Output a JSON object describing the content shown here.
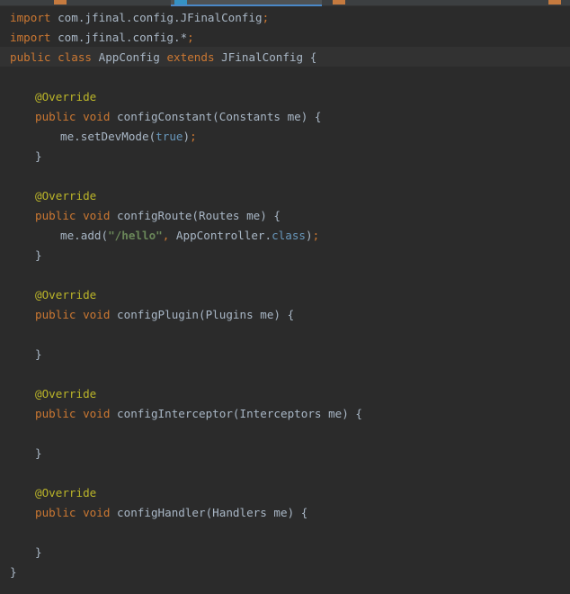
{
  "tabs": [
    {
      "label": "...",
      "active": false,
      "icon": "java-class-icon"
    },
    {
      "label": "...",
      "active": true,
      "icon": "java-class-icon"
    },
    {
      "label": "...",
      "active": false,
      "icon": "java-class-icon"
    },
    {
      "label": "",
      "active": false,
      "icon": "java-class-icon"
    }
  ],
  "colors": {
    "background": "#2b2b2b",
    "keyword": "#cc7832",
    "annotation": "#bbb529",
    "string": "#6a8759",
    "literal": "#6897bb",
    "text": "#a9b7c6",
    "current_line": "#323232"
  },
  "code": {
    "l1": {
      "kw": "import",
      "rest": "com.jfinal.config.JFinalConfig",
      "semi": ";"
    },
    "l2": {
      "kw": "import",
      "rest": "com.jfinal.config.*",
      "semi": ";"
    },
    "l3": {
      "kw1": "public",
      "kw2": "class",
      "name": "AppConfig",
      "kw3": "extends",
      "parent": "JFinalConfig",
      "brace": "{"
    },
    "override": "@Override",
    "public": "public",
    "void": "void",
    "m1": {
      "sig": "configConstant(Constants me) {",
      "body_pre": "me.setDevMode(",
      "body_lit": "true",
      "body_post": ")",
      "semi": ";"
    },
    "m2": {
      "sig": "configRoute(Routes me) {",
      "body_pre": "me.add(",
      "body_str": "\"/hello\"",
      "body_comma": ",",
      "body_mid": " AppController.",
      "body_cls": "class",
      "body_post": ")",
      "semi": ";"
    },
    "m3": {
      "sig": "configPlugin(Plugins me) {"
    },
    "m4": {
      "sig": "configInterceptor(Interceptors me) {"
    },
    "m5": {
      "sig": "configHandler(Handlers me) {"
    },
    "close": "}",
    "class_close": "}"
  }
}
